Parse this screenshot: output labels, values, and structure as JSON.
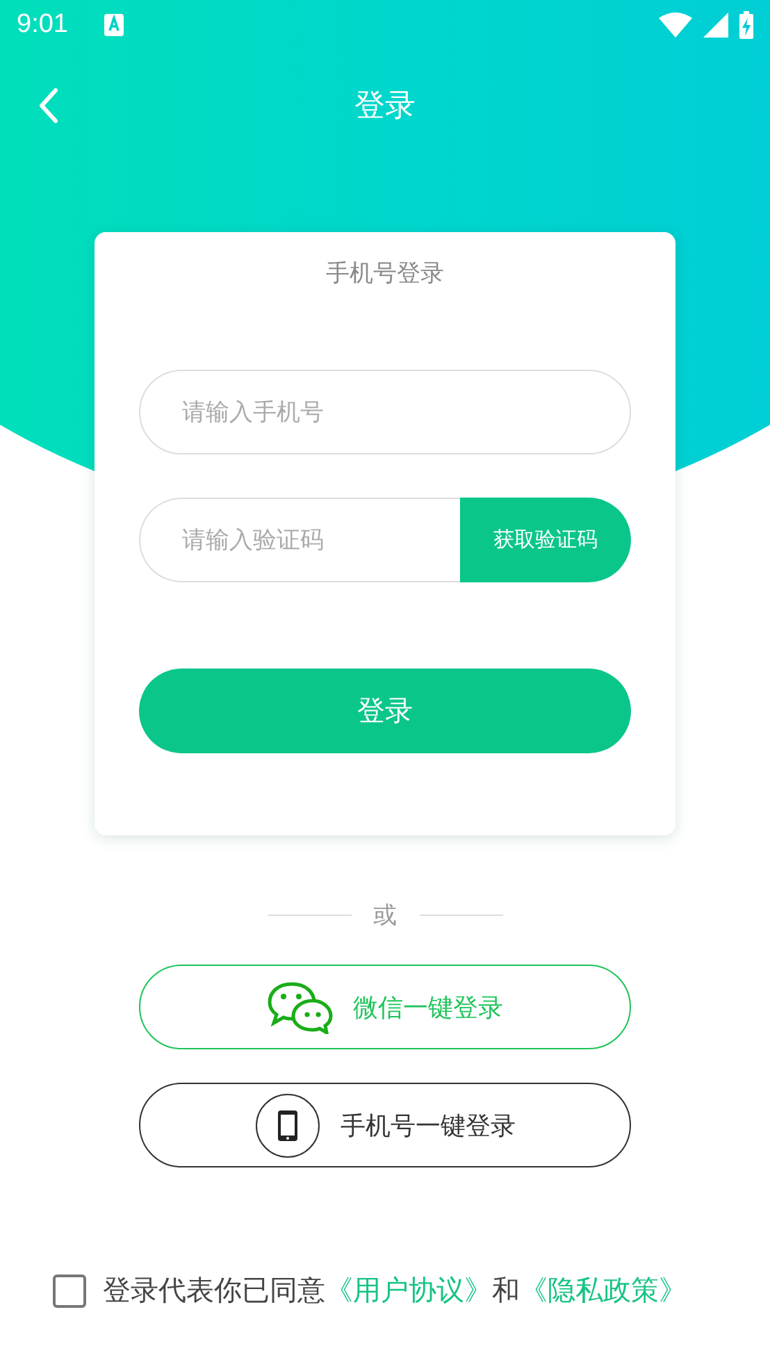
{
  "status_bar": {
    "time": "9:01"
  },
  "nav": {
    "title": "登录"
  },
  "card": {
    "title": "手机号登录",
    "phone_field": {
      "placeholder": "请输入手机号"
    },
    "code_field": {
      "placeholder": "请输入验证码"
    },
    "code_button": "获取验证码",
    "login_button": "登录"
  },
  "divider_text": "或",
  "alt_logins": [
    {
      "kind": "wechat",
      "label": "微信一键登录"
    },
    {
      "kind": "phone",
      "label": "手机号一键登录"
    }
  ],
  "agreement": {
    "checked": false,
    "parts": [
      {
        "kind": "text",
        "text": "登录代表你已同意"
      },
      {
        "kind": "link",
        "text": "《用户协议》"
      },
      {
        "kind": "text",
        "text": "和"
      },
      {
        "kind": "link",
        "text": "《隐私政策》"
      }
    ]
  }
}
